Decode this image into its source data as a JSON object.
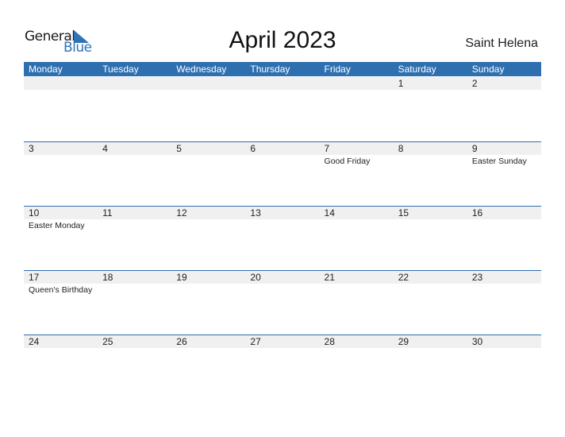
{
  "logo": {
    "line1": "General",
    "line2": "Blue"
  },
  "title": "April 2023",
  "country": "Saint Helena",
  "colors": {
    "accent": "#2e6fb0",
    "strip": "#f0f0f0"
  },
  "weekdays": [
    "Monday",
    "Tuesday",
    "Wednesday",
    "Thursday",
    "Friday",
    "Saturday",
    "Sunday"
  ],
  "weeks": [
    [
      {
        "day": ""
      },
      {
        "day": ""
      },
      {
        "day": ""
      },
      {
        "day": ""
      },
      {
        "day": ""
      },
      {
        "day": "1"
      },
      {
        "day": "2"
      }
    ],
    [
      {
        "day": "3"
      },
      {
        "day": "4"
      },
      {
        "day": "5"
      },
      {
        "day": "6"
      },
      {
        "day": "7",
        "holiday": "Good Friday"
      },
      {
        "day": "8"
      },
      {
        "day": "9",
        "holiday": "Easter Sunday"
      }
    ],
    [
      {
        "day": "10",
        "holiday": "Easter Monday"
      },
      {
        "day": "11"
      },
      {
        "day": "12"
      },
      {
        "day": "13"
      },
      {
        "day": "14"
      },
      {
        "day": "15"
      },
      {
        "day": "16"
      }
    ],
    [
      {
        "day": "17",
        "holiday": "Queen's Birthday"
      },
      {
        "day": "18"
      },
      {
        "day": "19"
      },
      {
        "day": "20"
      },
      {
        "day": "21"
      },
      {
        "day": "22"
      },
      {
        "day": "23"
      }
    ],
    [
      {
        "day": "24"
      },
      {
        "day": "25"
      },
      {
        "day": "26"
      },
      {
        "day": "27"
      },
      {
        "day": "28"
      },
      {
        "day": "29"
      },
      {
        "day": "30"
      }
    ]
  ]
}
